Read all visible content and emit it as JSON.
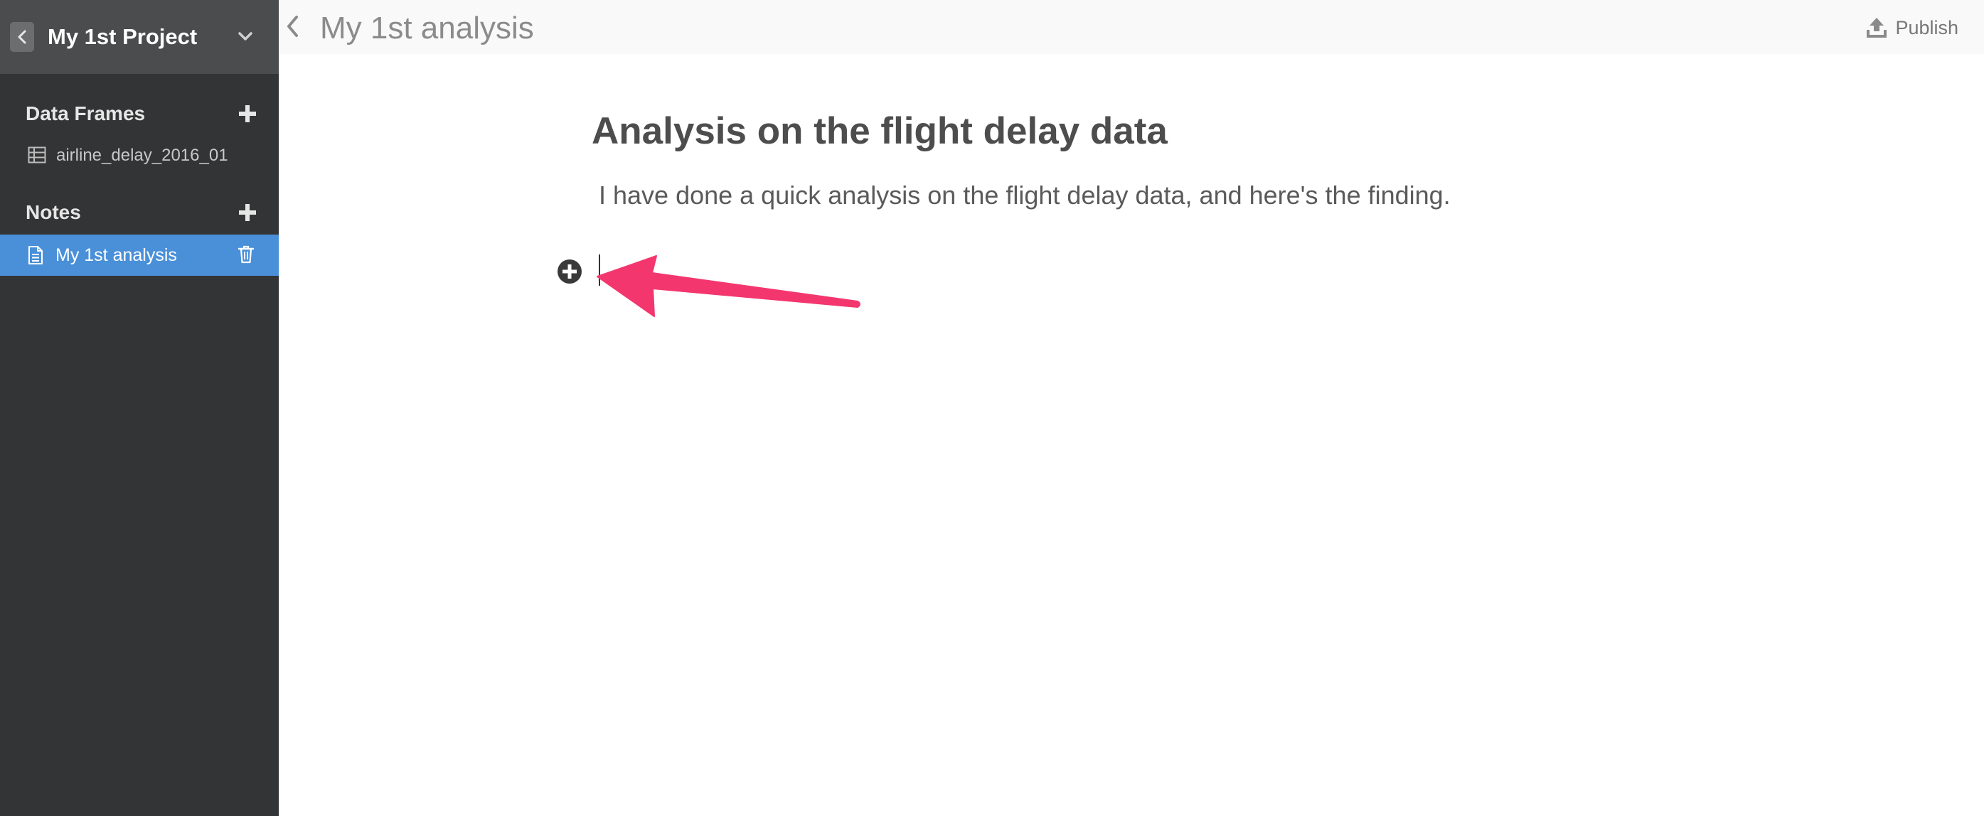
{
  "sidebar": {
    "project_title": "My 1st Project",
    "sections": {
      "data_frames": {
        "header": "Data Frames",
        "items": [
          {
            "label": "airline_delay_2016_01",
            "icon": "table-icon"
          }
        ]
      },
      "notes": {
        "header": "Notes",
        "items": [
          {
            "label": "My 1st analysis",
            "icon": "document-icon",
            "selected": true
          }
        ]
      }
    }
  },
  "topbar": {
    "title": "My 1st analysis",
    "publish_label": "Publish"
  },
  "document": {
    "heading": "Analysis on the flight delay data",
    "paragraph": "I have done a quick analysis on the flight delay data, and here's the finding."
  },
  "colors": {
    "sidebar_bg": "#333435",
    "sidebar_header_bg": "#4b4c4d",
    "selected_item_bg": "#4a90d9",
    "annotation_arrow": "#f4366e"
  },
  "icons": {
    "back": "chevron-left-icon",
    "project_menu": "chevron-down-icon",
    "add": "plus-icon",
    "data_frame": "table-icon",
    "note": "document-icon",
    "delete": "trash-icon",
    "collapse": "chevron-left-icon",
    "publish": "upload-icon",
    "add_block": "plus-circle-icon"
  }
}
